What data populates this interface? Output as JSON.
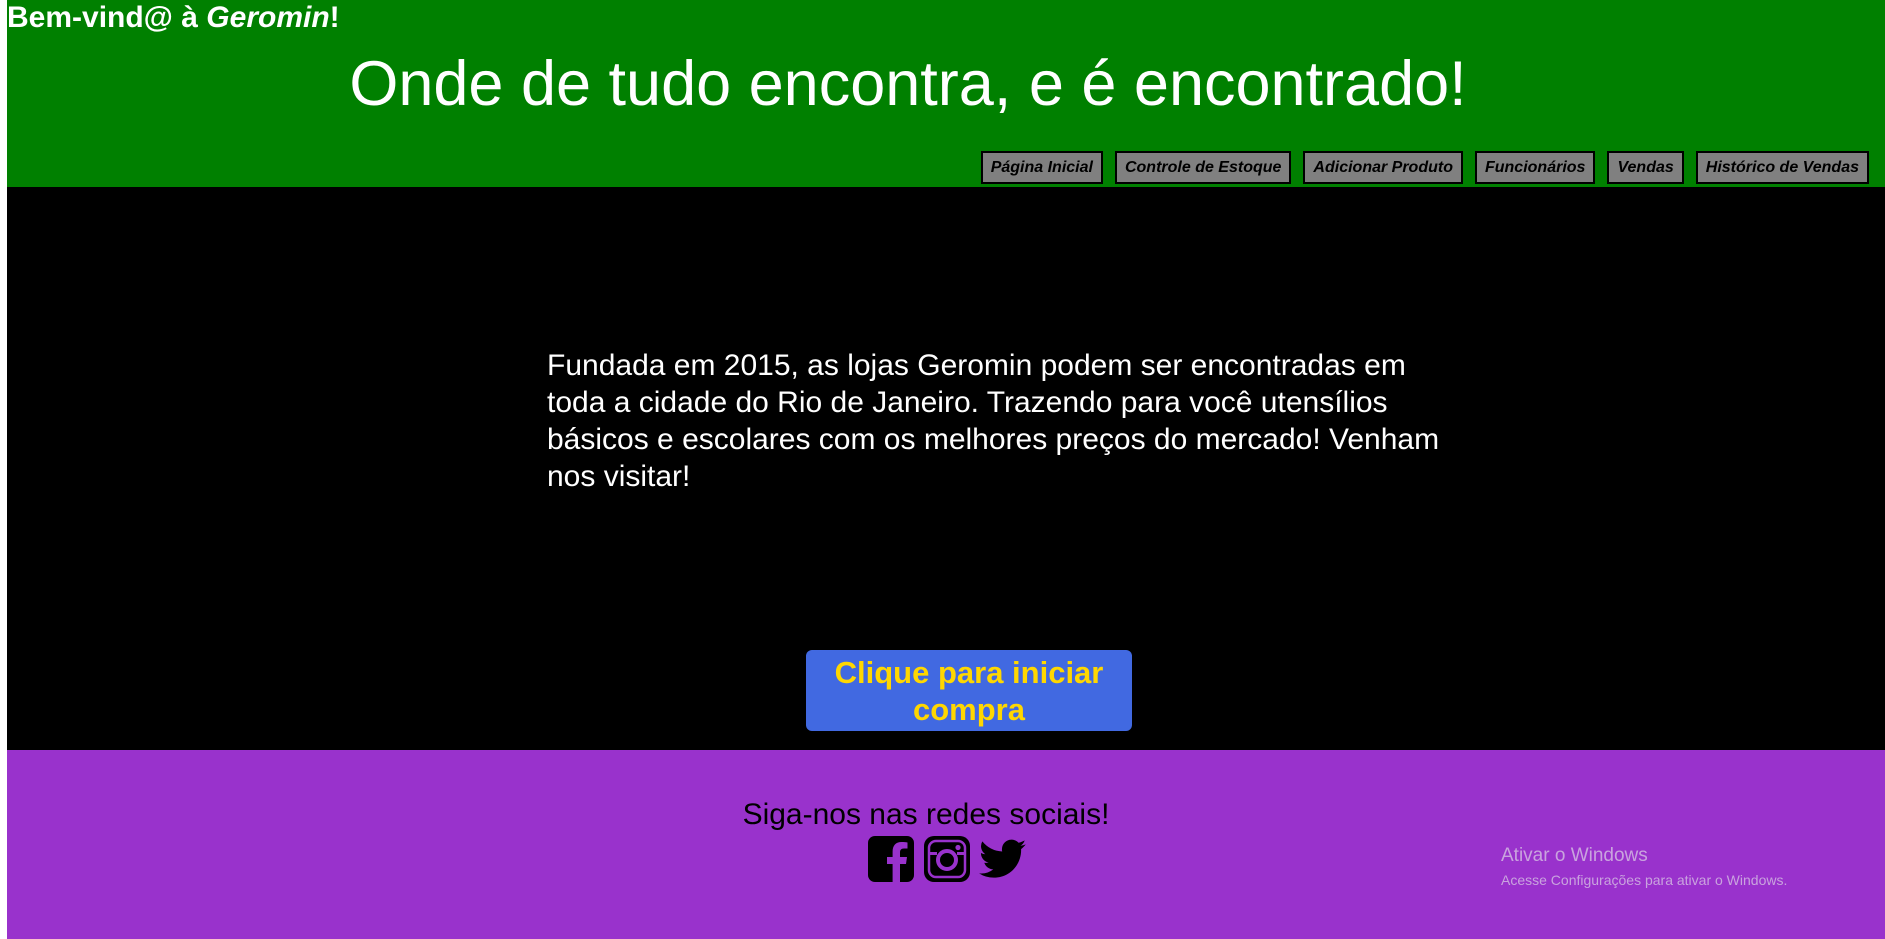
{
  "header": {
    "welcome_prefix": "Bem-vind@ à ",
    "welcome_brand": "Geromin",
    "welcome_suffix": "!",
    "tagline": "Onde de tudo encontra, e é encontrado!",
    "nav": [
      {
        "label": "Página Inicial"
      },
      {
        "label": "Controle de Estoque"
      },
      {
        "label": "Adicionar Produto"
      },
      {
        "label": "Funcionários"
      },
      {
        "label": "Vendas"
      },
      {
        "label": "Histórico de Vendas"
      }
    ]
  },
  "main": {
    "intro_text": "Fundada em 2015, as lojas Geromin podem ser encontradas em toda a cidade do Rio de Janeiro. Trazendo para você utensílios básicos e escolares com os melhores preços do mercado! Venham nos visitar!",
    "buy_button_label": "Clique para iniciar compra"
  },
  "footer": {
    "follow_text": "Siga-nos nas redes sociais!",
    "social": [
      {
        "icon": "facebook-icon"
      },
      {
        "icon": "instagram-icon"
      },
      {
        "icon": "twitter-icon"
      }
    ],
    "watermark_title": "Ativar o Windows",
    "watermark_subtitle": "Acesse Configurações para ativar o Windows."
  },
  "colors": {
    "header_bg": "#008000",
    "main_bg": "#000000",
    "footer_bg": "#9932cc",
    "button_bg": "#4169e1",
    "button_text": "#ffd700",
    "nav_bg": "#808080"
  }
}
